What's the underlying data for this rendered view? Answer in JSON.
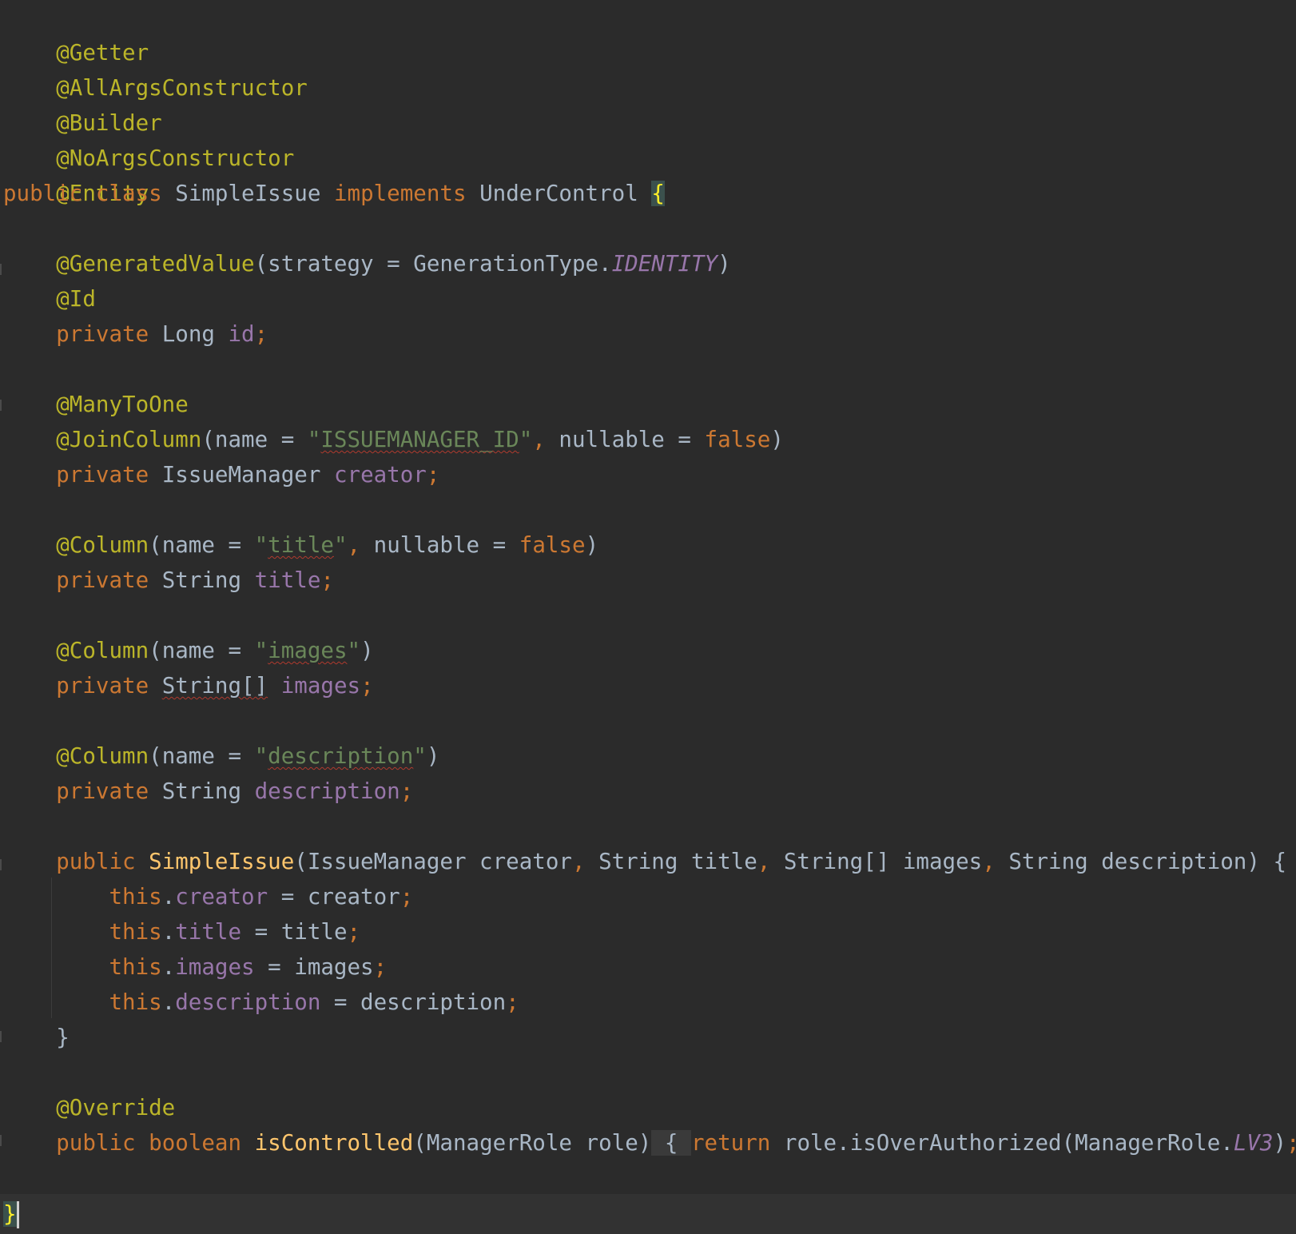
{
  "code": {
    "anno_getter": "@Getter",
    "anno_allargs": "@AllArgsConstructor",
    "anno_builder": "@Builder",
    "anno_noargs": "@NoArgsConstructor",
    "anno_entity": "@Entity",
    "class_decl": {
      "kw_public": "public",
      "kw_class": "class",
      "class_name": "SimpleIssue",
      "kw_implements": "implements",
      "interface_name": "UnderControl",
      "open_brace": "{"
    },
    "generated_value": {
      "anno": "@GeneratedValue",
      "open": "(strategy = GenerationType.",
      "constant": "IDENTITY",
      "close": ")"
    },
    "anno_id": "@Id",
    "field_id": {
      "kw": "private",
      "type": "Long",
      "name": "id",
      "semi": ";"
    },
    "anno_many_to_one": "@ManyToOne",
    "join_column": {
      "anno": "@JoinColumn",
      "open": "(name = ",
      "quote_open": "\"",
      "value": "ISSUEMANAGER_ID",
      "quote_close": "\"",
      "comma": ",",
      "attr": " nullable = ",
      "bool": "false",
      "close": ")"
    },
    "field_creator": {
      "kw": "private",
      "type": "IssueManager",
      "name": "creator",
      "semi": ";"
    },
    "column_title": {
      "anno": "@Column",
      "open": "(name = ",
      "quote_open": "\"",
      "value": "title",
      "quote_close": "\"",
      "comma": ",",
      "attr": " nullable = ",
      "bool": "false",
      "close": ")"
    },
    "field_title": {
      "kw": "private",
      "type": "String",
      "name": "title",
      "semi": ";"
    },
    "column_images": {
      "anno": "@Column",
      "open": "(name = ",
      "quote_open": "\"",
      "value": "images",
      "quote_close": "\"",
      "close": ")"
    },
    "field_images": {
      "kw": "private",
      "type": "String[]",
      "name": "images",
      "semi": ";"
    },
    "column_description": {
      "anno": "@Column",
      "open": "(name = ",
      "quote_open": "\"",
      "value": "description",
      "quote_close": "\"",
      "close": ")"
    },
    "field_description": {
      "kw": "private",
      "type": "String",
      "name": "description",
      "semi": ";"
    },
    "constructor": {
      "kw": "public",
      "name": "SimpleIssue",
      "p1": "(IssueManager creator",
      "c1": ",",
      "p2": " String title",
      "c2": ",",
      "p3": " String[] images",
      "c3": ",",
      "p4": " String description) {"
    },
    "assign_creator": {
      "this": "this",
      "dot": ".",
      "field": "creator",
      "rest": " = creator",
      "semi": ";"
    },
    "assign_title": {
      "this": "this",
      "dot": ".",
      "field": "title",
      "rest": " = title",
      "semi": ";"
    },
    "assign_images": {
      "this": "this",
      "dot": ".",
      "field": "images",
      "rest": " = images",
      "semi": ";"
    },
    "assign_description": {
      "this": "this",
      "dot": ".",
      "field": "description",
      "rest": " = description",
      "semi": ";"
    },
    "constructor_close": "}",
    "anno_override": "@Override",
    "method": {
      "kw_public": "public",
      "kw_boolean": "boolean",
      "name": "isControlled",
      "params": "(ManagerRole role)",
      "fold_open": " { ",
      "kw_return": "return",
      "call": " role.isOverAuthorized(ManagerRole.",
      "constant": "LV3",
      "call_close": ")",
      "semi": ";",
      "fold_close": " }"
    },
    "class_close": "}"
  },
  "colors": {
    "background": "#2b2b2b",
    "annotation": "#bbb529",
    "keyword": "#cc7832",
    "string": "#6a8759",
    "field": "#9876aa",
    "method": "#ffc66d",
    "plain": "#a9b7c6"
  }
}
